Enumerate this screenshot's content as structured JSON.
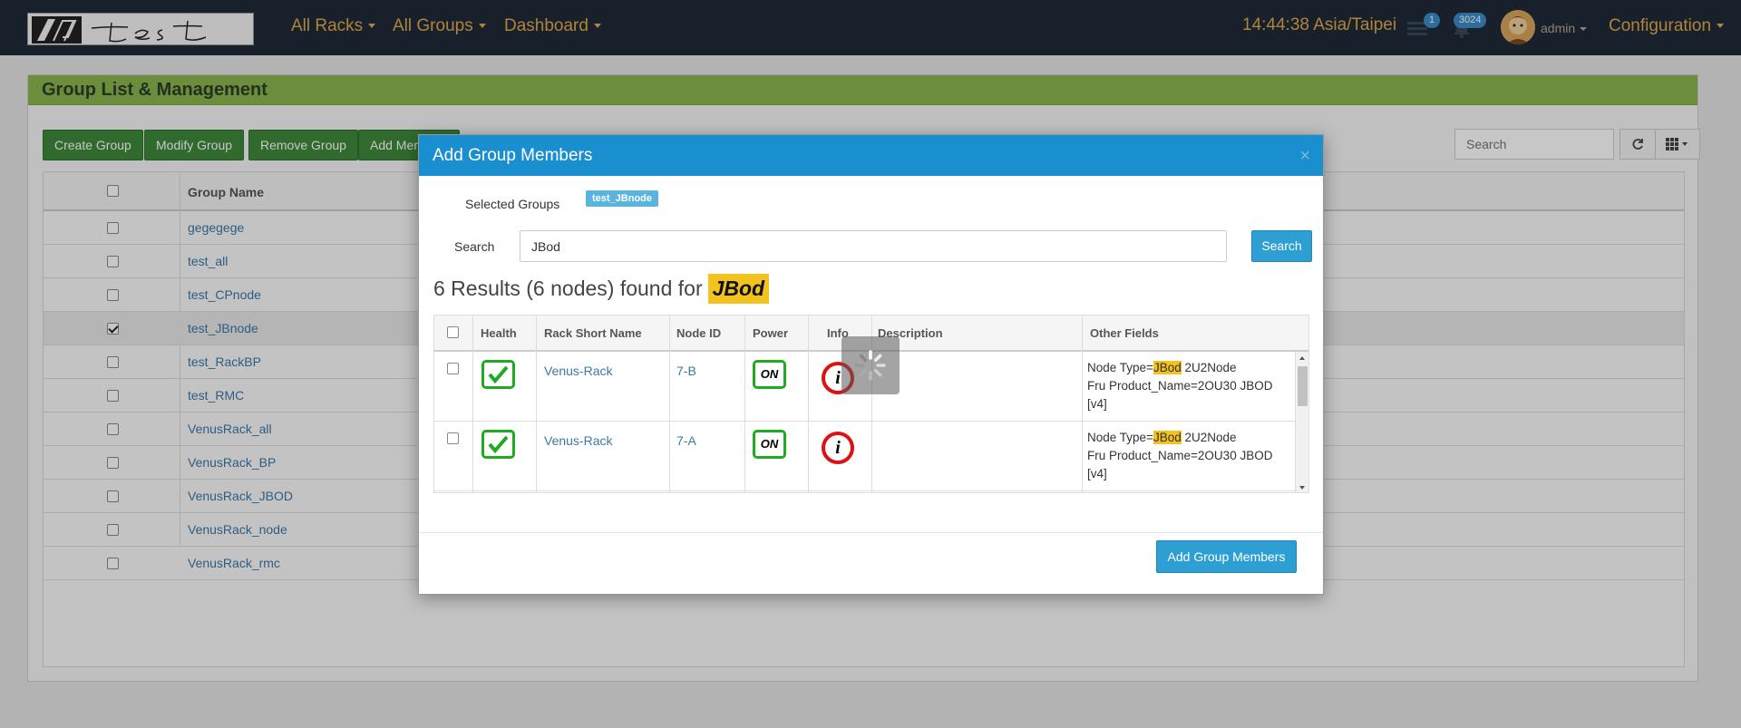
{
  "navbar": {
    "menus": [
      "All Racks",
      "All Groups",
      "Dashboard"
    ],
    "clock": "14:44:38 Asia/Taipei",
    "tasks_badge": "1",
    "alerts_badge": "3024",
    "user": "admin",
    "configuration": "Configuration",
    "logo_alt": "test"
  },
  "panel": {
    "title": "Group List & Management",
    "buttons": [
      "Create Group",
      "Modify Group",
      "Remove Group",
      "Add Members"
    ],
    "search_placeholder": "Search",
    "column_header": "Group Name",
    "groups": [
      {
        "name": "gegegege",
        "checked": false
      },
      {
        "name": "test_all",
        "checked": false
      },
      {
        "name": "test_CPnode",
        "checked": false
      },
      {
        "name": "test_JBnode",
        "checked": true
      },
      {
        "name": "test_RackBP",
        "checked": false
      },
      {
        "name": "test_RMC",
        "checked": false
      },
      {
        "name": "VenusRack_all",
        "checked": false
      },
      {
        "name": "VenusRack_BP",
        "checked": false
      },
      {
        "name": "VenusRack_JBOD",
        "checked": false
      },
      {
        "name": "VenusRack_node",
        "checked": false
      },
      {
        "name": "VenusRack_rmc",
        "checked": false
      }
    ]
  },
  "modal": {
    "title": "Add Group Members",
    "close": "×",
    "selected_groups_label": "Selected Groups",
    "selected_group_tag": "test_JBnode",
    "search_label": "Search",
    "search_value": "JBod",
    "search_button": "Search",
    "results_prefix": "6 Results (6 nodes) found for",
    "results_term": "JBod",
    "columns": [
      "Health",
      "Rack Short Name",
      "Node ID",
      "Power",
      "Info",
      "Description",
      "Other Fields"
    ],
    "power_label": "ON",
    "info_label": "i",
    "rows": [
      {
        "rack": "Venus-Rack",
        "node_id": "7-B",
        "node_type_prefix": "Node Type=",
        "node_type_hl": "JBod",
        "node_type_suffix": " 2U2Node",
        "fru": "Fru Product_Name=2OU30 JBOD [v4]"
      },
      {
        "rack": "Venus-Rack",
        "node_id": "7-A",
        "node_type_prefix": "Node Type=",
        "node_type_hl": "JBod",
        "node_type_suffix": " 2U2Node",
        "fru": "Fru Product_Name=2OU30 JBOD [v4]"
      }
    ],
    "submit_button": "Add Group Members"
  },
  "colors": {
    "navbar": "#1f2b38",
    "nav_text": "#e0a84a",
    "panel_heading": "#8ab54e",
    "btn_green": "#3e8a3a",
    "modal_header": "#1a8fcf",
    "highlight": "#f2c21f",
    "health_ok": "#1faa1f",
    "info_red": "#dd1111"
  }
}
